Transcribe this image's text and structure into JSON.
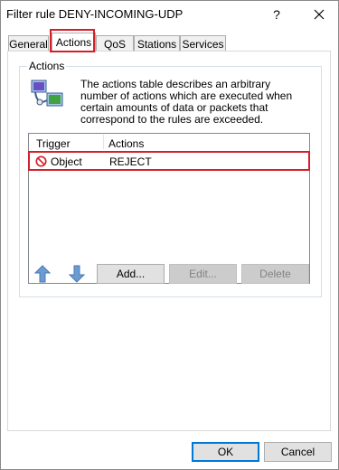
{
  "window": {
    "title": "Filter rule DENY-INCOMING-UDP",
    "help_label": "?",
    "close_icon": "close-icon"
  },
  "tabs": [
    {
      "label": "General",
      "active": false
    },
    {
      "label": "Actions",
      "active": true
    },
    {
      "label": "QoS",
      "active": false
    },
    {
      "label": "Stations",
      "active": false
    },
    {
      "label": "Services",
      "active": false
    }
  ],
  "actions_group": {
    "label": "Actions",
    "description": "The actions table describes an arbitrary number of actions which are executed when certain amounts of data or packets that correspond to the rules are exceeded.",
    "icon": "network-info-icon"
  },
  "table": {
    "columns": [
      "Trigger",
      "Actions"
    ],
    "rows": [
      {
        "icon": "prohibited-icon",
        "trigger": "Object",
        "action": "REJECT"
      }
    ]
  },
  "buttons": {
    "move_up_icon": "arrow-up-icon",
    "move_down_icon": "arrow-down-icon",
    "add": "Add...",
    "edit": "Edit...",
    "delete": "Delete",
    "ok": "OK",
    "cancel": "Cancel"
  },
  "colors": {
    "highlight": "#d4202a",
    "focus": "#0078d7",
    "arrow": "#6b9bd2"
  }
}
